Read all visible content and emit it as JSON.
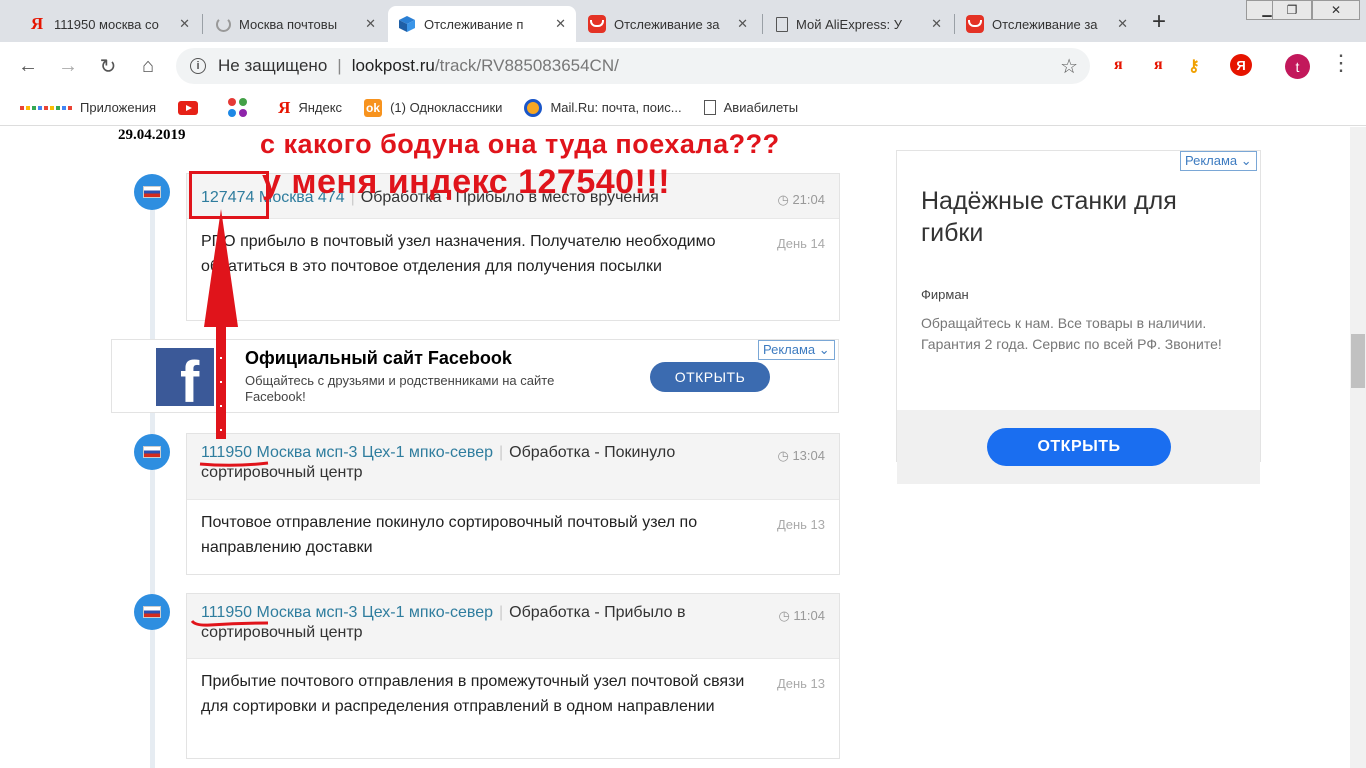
{
  "tabs": [
    {
      "icon": "yandex-icon",
      "title": "111950 москва со",
      "active": false
    },
    {
      "icon": "loading-icon",
      "title": "Москва почтовы",
      "active": false
    },
    {
      "icon": "parcel-icon",
      "title": "Отслеживание п",
      "active": true
    },
    {
      "icon": "aliexpress-icon",
      "title": "Отслеживание за",
      "active": false
    },
    {
      "icon": "page-icon",
      "title": "Мой AliExpress: У",
      "active": false
    },
    {
      "icon": "aliexpress-icon",
      "title": "Отслеживание за",
      "active": false
    }
  ],
  "toolbar": {
    "security_text": "Не защищено",
    "url_host": "lookpost.ru",
    "url_path": "/track/RV885083654CN/",
    "avatar_letter": "t"
  },
  "bookmarks": [
    {
      "icon": "apps-icon",
      "label": "Приложения"
    },
    {
      "icon": "youtube-icon",
      "label": ""
    },
    {
      "icon": "colorful-dots-icon",
      "label": ""
    },
    {
      "icon": "yandex-icon",
      "label": "Яндекс"
    },
    {
      "icon": "odnoklassniki-icon",
      "label": "(1) Одноклассники"
    },
    {
      "icon": "mailru-icon",
      "label": "Mail.Ru: почта, поис..."
    },
    {
      "icon": "page-icon",
      "label": "Авиабилеты"
    }
  ],
  "tracking": {
    "date": "29.04.2019",
    "events": [
      {
        "location": "127474 Москва 474",
        "status": "Обработка - Прибыло в место вручения",
        "time": "21:04",
        "description": "РПО прибыло в почтовый узел назначения. Получателю необходимо обратиться в это почтовое отделения для получения посылки",
        "day": "День 14"
      },
      {
        "location": "111950 Москва мсп-3 Цех-1 мпко-север",
        "status": "Обработка - Покинуло сортировочный центр",
        "time": "13:04",
        "description": "Почтовое отправление покинуло сортировочный почтовый узел по направлению доставки",
        "day": "День 13"
      },
      {
        "location": "111950 Москва мсп-3 Цех-1 мпко-север",
        "status": "Обработка - Прибыло в сортировочный центр",
        "time": "11:04",
        "description": "Прибытие почтового отправления в промежуточный узел почтовой связи для сортировки и распределения отправлений в одном направлении",
        "day": "День 13"
      }
    ]
  },
  "ads": {
    "label": "Реклама",
    "facebook": {
      "title": "Официальный сайт Facebook",
      "description": "Общайтесь с друзьями и родственниками на сайте Facebook!",
      "button": "ОТКРЫТЬ"
    },
    "side": {
      "title": "Надёжные станки для гибки",
      "brand": "Фирман",
      "description": "Обращайтесь к нам. Все товары в наличии. Гарантия 2 года. Сервис по всей РФ. Звоните!",
      "button": "ОТКРЫТЬ"
    }
  },
  "annotations": {
    "line1": "с какого бодуна она туда поехала???",
    "line2": "у меня индекс 127540!!!",
    "color": "#e0141b"
  }
}
